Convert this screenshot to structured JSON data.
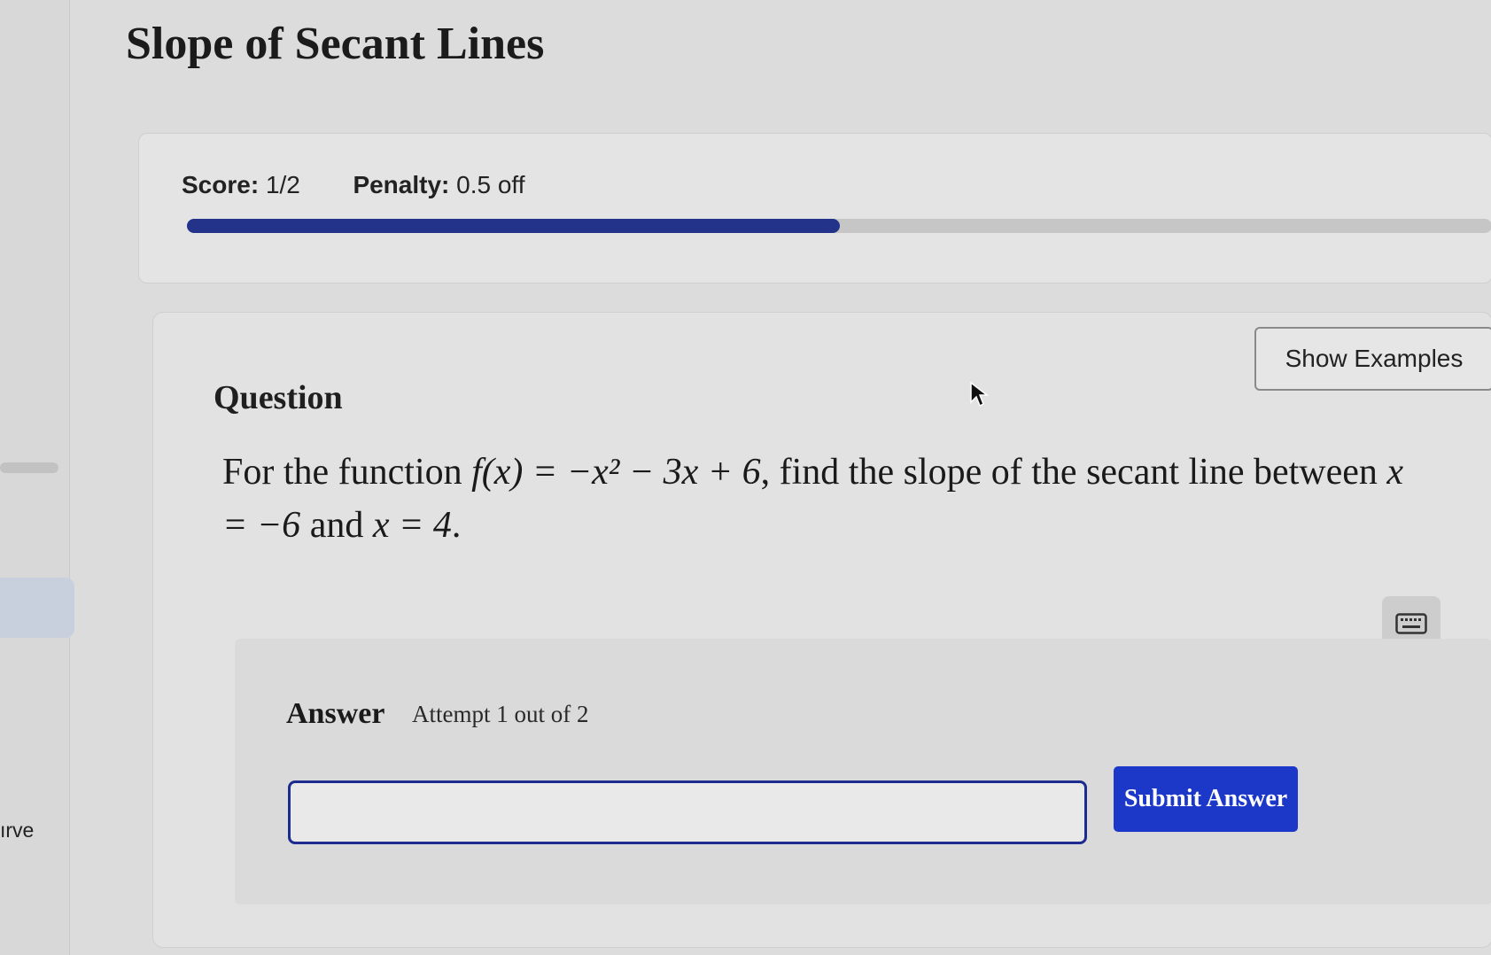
{
  "page": {
    "title": "Slope of Secant Lines"
  },
  "left_rail": {
    "partial_label": "ırve"
  },
  "score": {
    "score_label": "Score:",
    "score_value": "1/2",
    "penalty_label": "Penalty:",
    "penalty_value": "0.5 off",
    "progress_fraction": 0.5,
    "progress_color": "#23338a"
  },
  "question": {
    "heading": "Question",
    "show_examples_label": "Show Examples",
    "text_prefix": "For the function ",
    "function": "f(x) = −x² − 3x + 6",
    "text_middle": ", find the slope of the secant line between ",
    "x1": "x = −6",
    "text_and": " and ",
    "x2": "x = 4",
    "text_end": "."
  },
  "answer": {
    "label": "Answer",
    "attempt": "Attempt 1 out of 2",
    "input_value": "",
    "submit_label": "Submit Answer",
    "submit_color": "#1c38c9"
  },
  "icons": {
    "keyboard": "keyboard-icon",
    "cursor": "mouse-pointer-icon"
  }
}
